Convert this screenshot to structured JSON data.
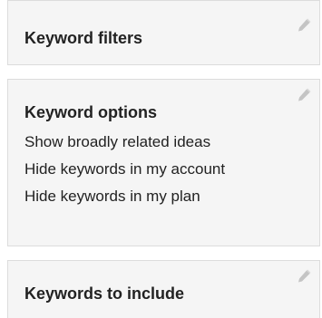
{
  "panels": {
    "keyword_filters": {
      "title": "Keyword filters",
      "icon": "pencil-icon"
    },
    "keyword_options": {
      "title": "Keyword options",
      "icon": "pencil-icon",
      "items": [
        "Show broadly related ideas",
        "Hide keywords in my account",
        "Hide keywords in my plan"
      ]
    },
    "keywords_to_include": {
      "title": "Keywords to include",
      "icon": "pencil-icon"
    }
  },
  "colors": {
    "panel_bg": "#f5f5f5",
    "panel_border": "#dcdcdc",
    "text": "#222222",
    "icon": "#c4c4c4"
  }
}
